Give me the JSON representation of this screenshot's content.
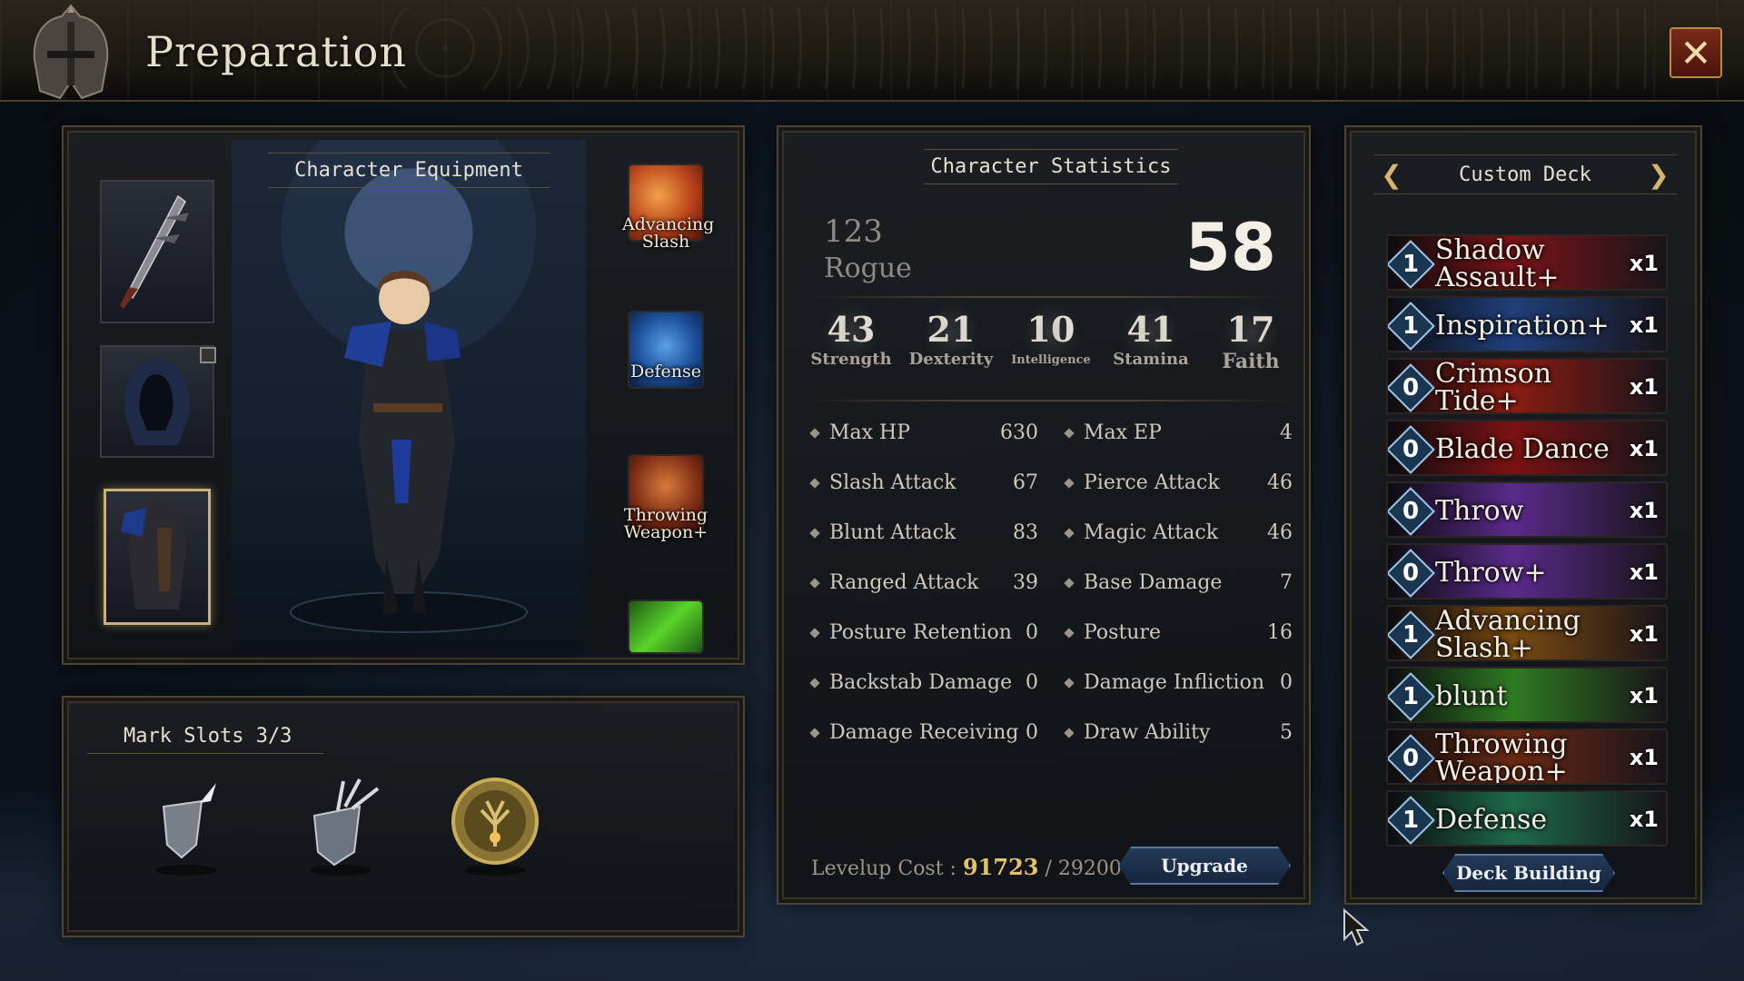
{
  "header": {
    "title": "Preparation"
  },
  "equipment": {
    "label": "Character Equipment",
    "skills": [
      "Advancing Slash",
      "Defense",
      "Throwing Weapon+"
    ]
  },
  "marks": {
    "label": "Mark Slots 3/3"
  },
  "stats": {
    "label": "Character Statistics",
    "level": "123",
    "class": "Rogue",
    "score": "58",
    "attributes": [
      {
        "value": "43",
        "label": "Strength"
      },
      {
        "value": "21",
        "label": "Dexterity"
      },
      {
        "value": "10",
        "label": "Intelligence"
      },
      {
        "value": "41",
        "label": "Stamina"
      },
      {
        "value": "17",
        "label": "Faith"
      }
    ],
    "left": [
      {
        "name": "Max HP",
        "value": "630"
      },
      {
        "name": "Slash Attack",
        "value": "67"
      },
      {
        "name": "Blunt Attack",
        "value": "83"
      },
      {
        "name": "Ranged Attack",
        "value": "39"
      },
      {
        "name": "Posture Retention",
        "value": "0"
      },
      {
        "name": "Backstab Damage",
        "value": "0"
      },
      {
        "name": "Damage Receiving",
        "value": "0"
      }
    ],
    "right": [
      {
        "name": "Max EP",
        "value": "4"
      },
      {
        "name": "Pierce Attack",
        "value": "46"
      },
      {
        "name": "Magic Attack",
        "value": "46"
      },
      {
        "name": "Base Damage",
        "value": "7"
      },
      {
        "name": "Posture",
        "value": "16"
      },
      {
        "name": "Damage Infliction",
        "value": "0"
      },
      {
        "name": "Draw Ability",
        "value": "5"
      }
    ],
    "levelup_label": "Levelup Cost :",
    "levelup_current": "91723",
    "levelup_sep": "/",
    "levelup_cost": "29200",
    "upgrade_label": "Upgrade"
  },
  "deck": {
    "title": "Custom Deck",
    "prev_icon": "chevron-left-icon",
    "next_icon": "chevron-right-icon",
    "cards": [
      {
        "cost": "1",
        "name": "Shadow Assault+",
        "qty": "x1",
        "color": "#7a1418"
      },
      {
        "cost": "1",
        "name": "Inspiration+",
        "qty": "x1",
        "color": "#1f3f7a"
      },
      {
        "cost": "0",
        "name": "Crimson Tide+",
        "qty": "x1",
        "color": "#8a1c12"
      },
      {
        "cost": "0",
        "name": "Blade Dance",
        "qty": "x1",
        "color": "#7a1212"
      },
      {
        "cost": "0",
        "name": "Throw",
        "qty": "x1",
        "color": "#5a2a8a"
      },
      {
        "cost": "0",
        "name": "Throw+",
        "qty": "x1",
        "color": "#5a2a8a"
      },
      {
        "cost": "1",
        "name": "Advancing Slash+",
        "qty": "x1",
        "color": "#7a4a12"
      },
      {
        "cost": "1",
        "name": "blunt",
        "qty": "x1",
        "color": "#2f7a22"
      },
      {
        "cost": "0",
        "name": "Throwing Weapon+",
        "qty": "x1",
        "color": "#6a2a14"
      },
      {
        "cost": "1",
        "name": "Defense",
        "qty": "x1",
        "color": "#1e6a4a"
      }
    ],
    "deck_building_label": "Deck Building"
  }
}
